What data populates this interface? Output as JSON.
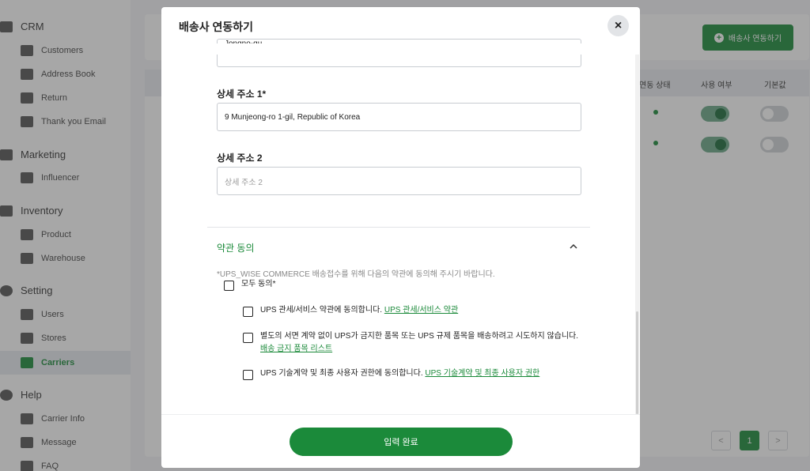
{
  "sidebar": {
    "sections": [
      {
        "label": "CRM",
        "items": [
          "Customers",
          "Address Book",
          "Return",
          "Thank you Email"
        ]
      },
      {
        "label": "Marketing",
        "items": [
          "Influencer"
        ]
      },
      {
        "label": "Inventory",
        "items": [
          "Product",
          "Warehouse"
        ]
      },
      {
        "label": "Setting",
        "items": [
          "Users",
          "Stores",
          "Carriers"
        ]
      },
      {
        "label": "Help",
        "items": [
          "Carrier Info",
          "Message",
          "FAQ"
        ]
      }
    ],
    "active_item": "Carriers"
  },
  "background": {
    "add_button_label": "배송사 연동하기",
    "columns": [
      "연동 상태",
      "사용 여부",
      "기본값"
    ],
    "pagination": {
      "prev": "<",
      "current": "1",
      "next": ">"
    }
  },
  "modal": {
    "title": "배송사 연동하기",
    "close_icon": "×",
    "partial_field_value": "Jongno-gu",
    "address1": {
      "label": "상세 주소 1*",
      "value": "9 Munjeong-ro 1-gil, Republic of Korea"
    },
    "address2": {
      "label": "상세 주소 2",
      "placeholder": "상세 주소 2"
    },
    "terms": {
      "title": "약관 동의",
      "note": "*UPS_WISE COMMERCE 배송접수를 위해 다음의 약관에 동의해 주시기 바랍니다.",
      "agree_all": "모두 동의*",
      "item1_text": "UPS 관세/서비스 약관에 동의합니다.",
      "item1_link": "UPS 관세/서비스 약관",
      "item2_text": "별도의 서면 계약 없이 UPS가 금지한 품목 또는 UPS 규제 품목을 배송하려고 시도하지 않습니다.",
      "item2_link": "배송 금지 품목 리스트",
      "item3_text": "UPS 기술계약 및 최종 사용자 권한에 동의합니다.",
      "item3_link": "UPS 기술계약 및 최종 사용자 권한"
    },
    "submit_label": "입력 완료"
  },
  "colors": {
    "brand_green": "#1b8a3a"
  }
}
